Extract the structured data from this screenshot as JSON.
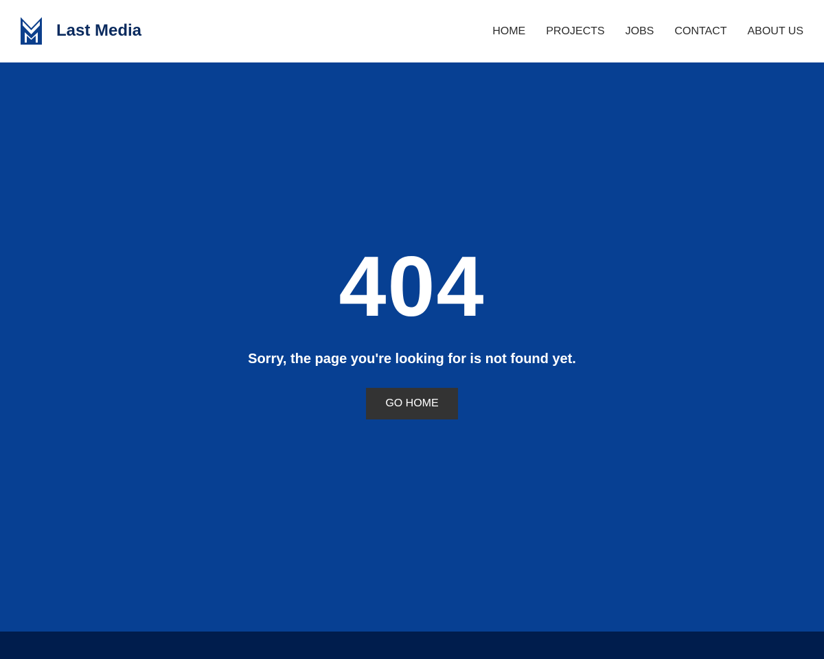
{
  "header": {
    "brand": {
      "name": "Last Media",
      "logo_icon": "m-chevron-logo-icon"
    },
    "nav": [
      {
        "label": "HOME"
      },
      {
        "label": "PROJECTS"
      },
      {
        "label": "JOBS"
      },
      {
        "label": "CONTACT"
      },
      {
        "label": "ABOUT US"
      }
    ]
  },
  "main": {
    "error_code": "404",
    "message": "Sorry, the page you're looking for is not found yet.",
    "button_label": "GO HOME"
  },
  "colors": {
    "header_bg": "#ffffff",
    "hero_bg": "#074093",
    "footer_bg": "#001d4d",
    "brand_text": "#0a2a5e",
    "button_bg": "#333333",
    "nav_text": "#2b2b2b"
  }
}
